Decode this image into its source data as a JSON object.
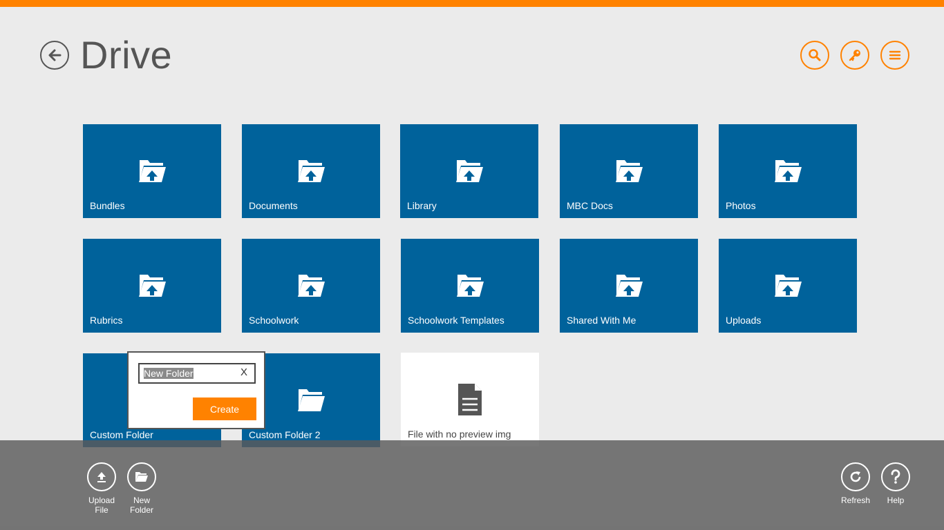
{
  "window": {
    "accent": "#ff8200",
    "tile_color": "#00629b"
  },
  "header": {
    "title": "Drive",
    "back_icon": "arrow-left-circle-icon",
    "actions": [
      {
        "name": "search",
        "icon": "search-icon"
      },
      {
        "name": "keys",
        "icon": "key-icon"
      },
      {
        "name": "menu",
        "icon": "hamburger-menu-icon"
      }
    ]
  },
  "folders": [
    {
      "label": "Bundles"
    },
    {
      "label": "Documents"
    },
    {
      "label": "Library"
    },
    {
      "label": "MBC Docs"
    },
    {
      "label": "Photos"
    },
    {
      "label": "Rubrics"
    },
    {
      "label": "Schoolwork"
    },
    {
      "label": "Schoolwork Templates"
    },
    {
      "label": "Shared With Me"
    },
    {
      "label": "Uploads"
    },
    {
      "label": "Custom Folder"
    },
    {
      "label": "Custom Folder 2"
    }
  ],
  "file": {
    "label": "File with no preview img",
    "icon": "document-icon"
  },
  "new_folder_popup": {
    "value": "New Folder",
    "clear_label": "X",
    "create_label": "Create"
  },
  "appbar": {
    "upload": {
      "label": "Upload\nFile",
      "icon": "upload-icon"
    },
    "new_folder": {
      "label": "New\nFolder",
      "icon": "folder-open-icon"
    },
    "refresh": {
      "label": "Refresh",
      "icon": "refresh-icon"
    },
    "help": {
      "label": "Help",
      "icon": "help-icon"
    }
  }
}
